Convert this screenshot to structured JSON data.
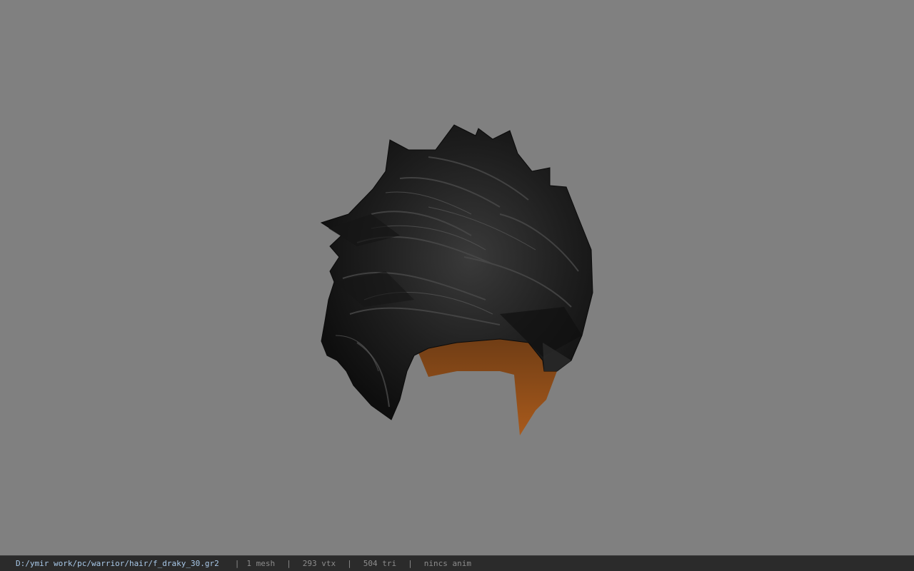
{
  "viewer": {
    "background_color": "#808080",
    "model_icon": "hair-mesh-model"
  },
  "statusbar": {
    "file_path": "D:/ymir work/pc/warrior/hair/f_draky_30.gr2",
    "separator": "|",
    "mesh_count": "1 mesh",
    "vertex_count": "293 vtx",
    "triangle_count": "504 tri",
    "animation": "nincs anim"
  }
}
